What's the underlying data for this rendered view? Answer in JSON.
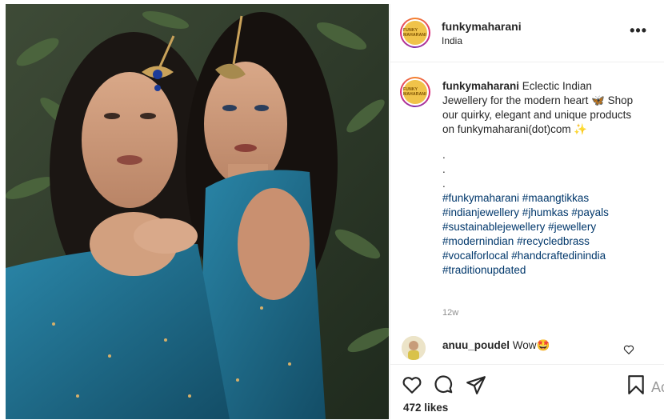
{
  "post": {
    "username": "funkymaharani",
    "location": "India",
    "more_label": "•••",
    "avatar_text": "FUNKY MAHARANI"
  },
  "caption": {
    "username": "funkymaharani",
    "text": "Eclectic Indian Jewellery for the modern heart 🦋 Shop our quirky, elegant and unique products on funkymaharani(dot)com ✨",
    "dots": [
      ".",
      ".",
      "."
    ],
    "hashtags": "#funkymaharani #maangtikkas #indianjewellery #jhumkas #payals #sustainablejewellery #jewellery #modernindian #recycledbrass #vocalforlocal #handcraftedinindia #traditionupdated",
    "time": "12w"
  },
  "comment": {
    "username": "anuu_poudel",
    "text": "Wow🤩"
  },
  "actions": {
    "like_icon": "heart-icon",
    "comment_icon": "comment-icon",
    "share_icon": "share-icon",
    "save_icon": "bookmark-icon",
    "likes": "472 likes"
  },
  "edge_text": "Ac",
  "colors": {
    "hashtag": "#00376b",
    "muted": "#8e8e8e",
    "text": "#262626",
    "dress_teal": "#1f6e8c"
  }
}
